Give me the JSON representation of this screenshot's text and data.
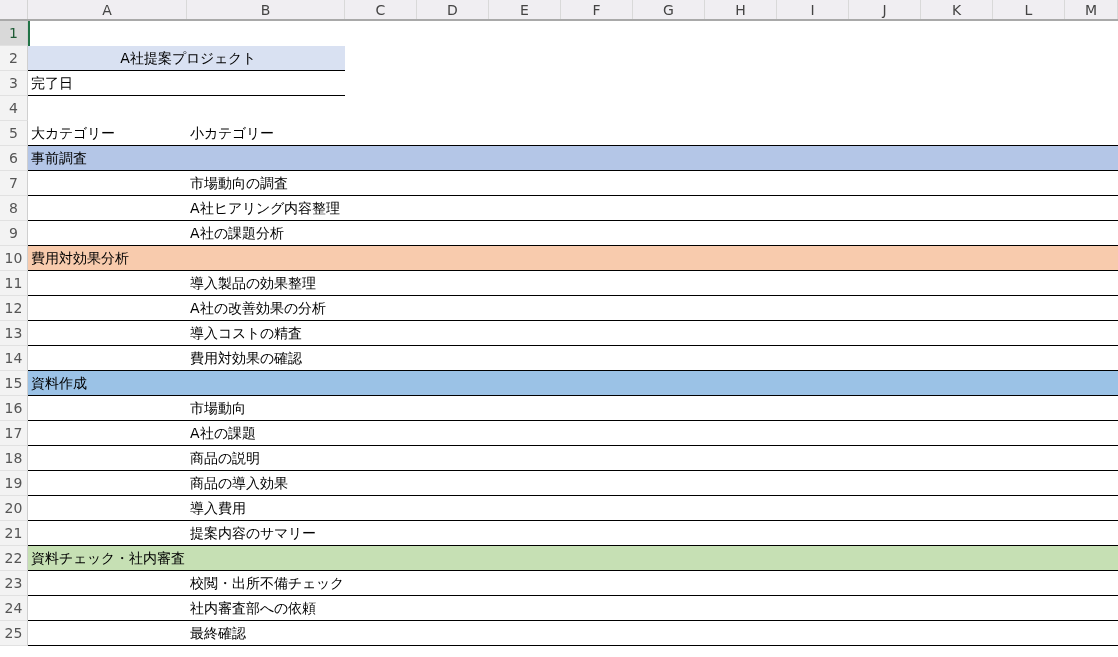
{
  "columns": [
    "A",
    "B",
    "C",
    "D",
    "E",
    "F",
    "G",
    "H",
    "I",
    "J",
    "K",
    "L",
    "M"
  ],
  "rows": [
    {
      "number": "1",
      "kind": "blank",
      "selected": true
    },
    {
      "number": "2",
      "kind": "title",
      "text": "A社提案プロジェクト",
      "selected": false
    },
    {
      "number": "3",
      "kind": "label",
      "text": "完了日",
      "selected": false
    },
    {
      "number": "4",
      "kind": "blank",
      "selected": false
    },
    {
      "number": "5",
      "kind": "header",
      "cells": [
        "大カテゴリー",
        "小カテゴリー"
      ],
      "selected": false
    },
    {
      "number": "6",
      "kind": "category",
      "text": "事前調査",
      "color": "#b4c6e7",
      "selected": false
    },
    {
      "number": "7",
      "kind": "item",
      "text": "市場動向の調査",
      "selected": false
    },
    {
      "number": "8",
      "kind": "item",
      "text": "A社ヒアリング内容整理",
      "selected": false
    },
    {
      "number": "9",
      "kind": "item",
      "text": "A社の課題分析",
      "selected": false
    },
    {
      "number": "10",
      "kind": "category",
      "text": "費用対効果分析",
      "color": "#f8cbad",
      "selected": false
    },
    {
      "number": "11",
      "kind": "item",
      "text": "導入製品の効果整理",
      "selected": false
    },
    {
      "number": "12",
      "kind": "item",
      "text": "A社の改善効果の分析",
      "selected": false
    },
    {
      "number": "13",
      "kind": "item",
      "text": "導入コストの精査",
      "selected": false
    },
    {
      "number": "14",
      "kind": "item",
      "text": "費用対効果の確認",
      "selected": false
    },
    {
      "number": "15",
      "kind": "category",
      "text": "資料作成",
      "color": "#9bc2e6",
      "selected": false
    },
    {
      "number": "16",
      "kind": "item",
      "text": "市場動向",
      "selected": false
    },
    {
      "number": "17",
      "kind": "item",
      "text": "A社の課題",
      "selected": false
    },
    {
      "number": "18",
      "kind": "item",
      "text": "商品の説明",
      "selected": false
    },
    {
      "number": "19",
      "kind": "item",
      "text": "商品の導入効果",
      "selected": false
    },
    {
      "number": "20",
      "kind": "item",
      "text": "導入費用",
      "selected": false
    },
    {
      "number": "21",
      "kind": "item",
      "text": "提案内容のサマリー",
      "selected": false
    },
    {
      "number": "22",
      "kind": "category",
      "text": "資料チェック・社内審査",
      "color": "#c6e0b4",
      "selected": false
    },
    {
      "number": "23",
      "kind": "item",
      "text": "校閲・出所不備チェック",
      "selected": false
    },
    {
      "number": "24",
      "kind": "item",
      "text": "社内審査部への依頼",
      "selected": false
    },
    {
      "number": "25",
      "kind": "item",
      "text": "最終確認",
      "selected": false
    }
  ]
}
